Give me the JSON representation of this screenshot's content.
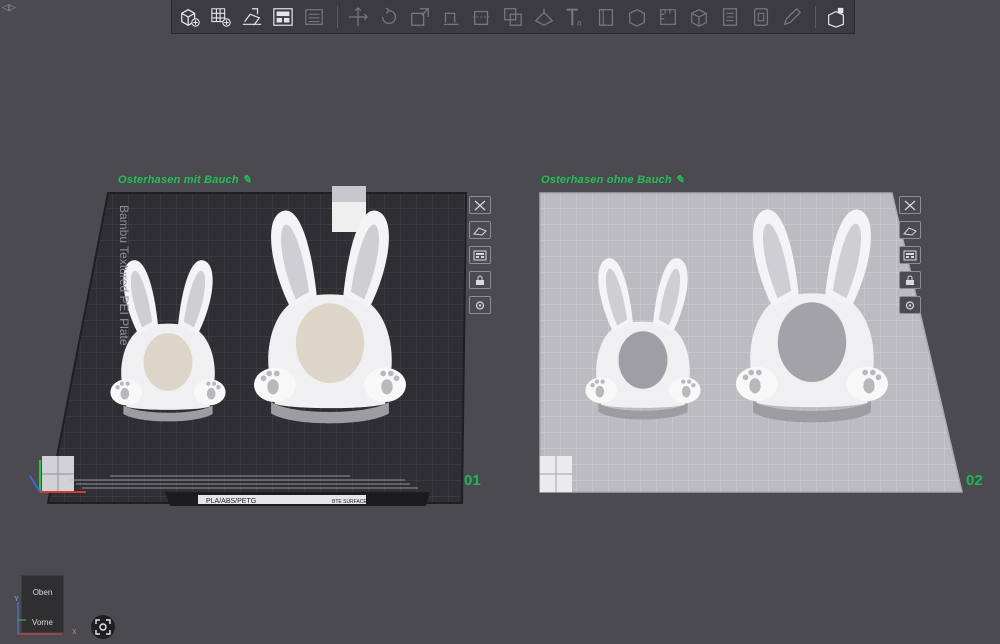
{
  "colors": {
    "accent": "#21c15a",
    "background": "#4b4a4f",
    "plate_dark": "#2f2f33",
    "plate_light": "#bcbcc0",
    "model": "#f2f2f2",
    "belly": "#ddd6c8"
  },
  "toolbar": {
    "buttons": [
      {
        "name": "add-object-icon"
      },
      {
        "name": "add-plate-icon"
      },
      {
        "name": "auto-orient-icon"
      },
      {
        "name": "arrange-icon"
      },
      {
        "name": "split-view-icon"
      },
      {
        "name": "move-icon"
      },
      {
        "name": "rotate-icon"
      },
      {
        "name": "scale-icon"
      },
      {
        "name": "lay-on-face-icon"
      },
      {
        "name": "cut-icon"
      },
      {
        "name": "mesh-boolean-icon"
      },
      {
        "name": "support-paint-icon"
      },
      {
        "name": "text-icon"
      },
      {
        "name": "seam-paint-icon"
      },
      {
        "name": "color-paint-icon"
      },
      {
        "name": "measure-icon"
      },
      {
        "name": "assembly-icon"
      },
      {
        "name": "variable-layer-icon"
      },
      {
        "name": "hollow-icon"
      },
      {
        "name": "pen-icon"
      },
      {
        "name": "view-settings-icon"
      }
    ]
  },
  "plates": [
    {
      "label": "Osterhasen mit Bauch",
      "number": "01",
      "plate_name": "Bambu Textured PEI Plate",
      "plate_bar": "PLA/ABS/PETG",
      "plate_bar_extra": "BTE SURFACE",
      "side_buttons": [
        "close-plate-icon",
        "auto-orient-plate-icon",
        "arrange-plate-icon",
        "lock-plate-icon",
        "plate-settings-icon"
      ]
    },
    {
      "label": "Osterhasen ohne Bauch",
      "number": "02",
      "side_buttons": [
        "close-plate-icon",
        "auto-orient-plate-icon",
        "arrange-plate-icon",
        "lock-plate-icon",
        "plate-settings-icon"
      ]
    }
  ],
  "nav_cube": {
    "top": "Oben",
    "front": "Vorne",
    "axis_x": "X",
    "axis_y": "Y"
  },
  "fit_view_icon": "fit-view-icon"
}
